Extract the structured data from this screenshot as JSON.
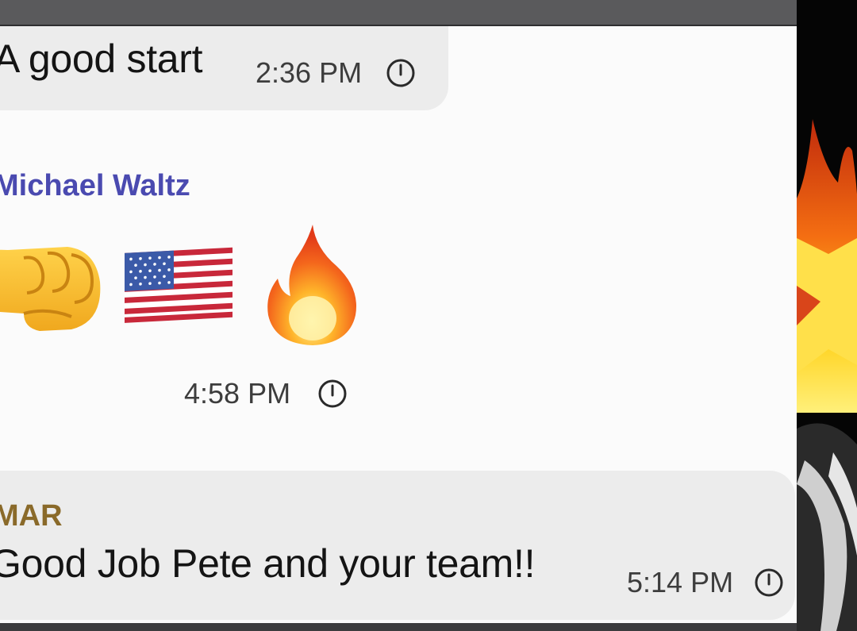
{
  "messages": [
    {
      "text": "A good start",
      "time": "2:36 PM",
      "status_icon": "clock-icon"
    },
    {
      "sender": "Michael Waltz",
      "sender_color": "#4a4ab0",
      "emojis": [
        "oncoming-fist",
        "us-flag",
        "fire"
      ],
      "time": "4:58 PM",
      "status_icon": "clock-icon"
    },
    {
      "sender": "MAR",
      "sender_color": "#8a6a2a",
      "text": "Good Job Pete and your team!!",
      "time": "5:14 PM",
      "status_icon": "clock-icon"
    }
  ],
  "colors": {
    "bubble": "#ececec",
    "background": "#fbfbfb",
    "text": "#141414",
    "time": "#3d3d3d"
  }
}
